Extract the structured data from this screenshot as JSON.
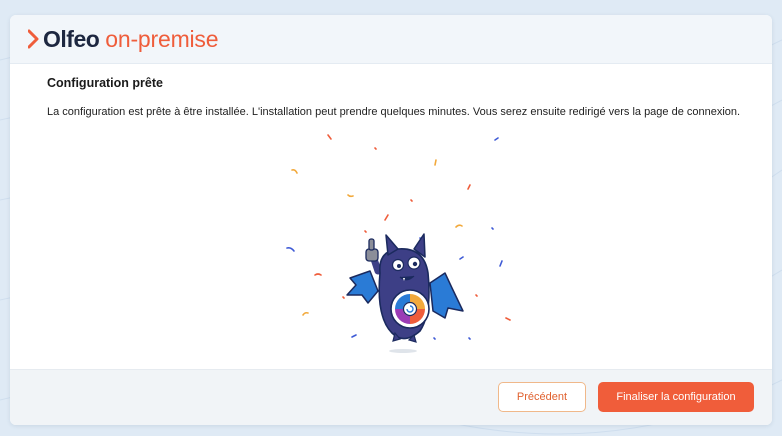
{
  "header": {
    "logo_brand": "Olfeo",
    "logo_product": "on-premise"
  },
  "main": {
    "title": "Configuration prête",
    "description": "La configuration est prête à être installée. L'installation peut prendre quelques minutes. Vous serez ensuite redirigé vers la page de connexion."
  },
  "footer": {
    "previous_label": "Précédent",
    "finish_label": "Finaliser la configuration"
  },
  "colors": {
    "brand_orange": "#ef5d3b",
    "brand_dark": "#1d2740",
    "mascot_body": "#3d3f86",
    "mascot_wing": "#2a7bd6"
  },
  "icons": {
    "logo_mark": "olfeo-logo-icon",
    "mascot": "bat-mascot-illustration",
    "confetti": "confetti-decoration"
  }
}
